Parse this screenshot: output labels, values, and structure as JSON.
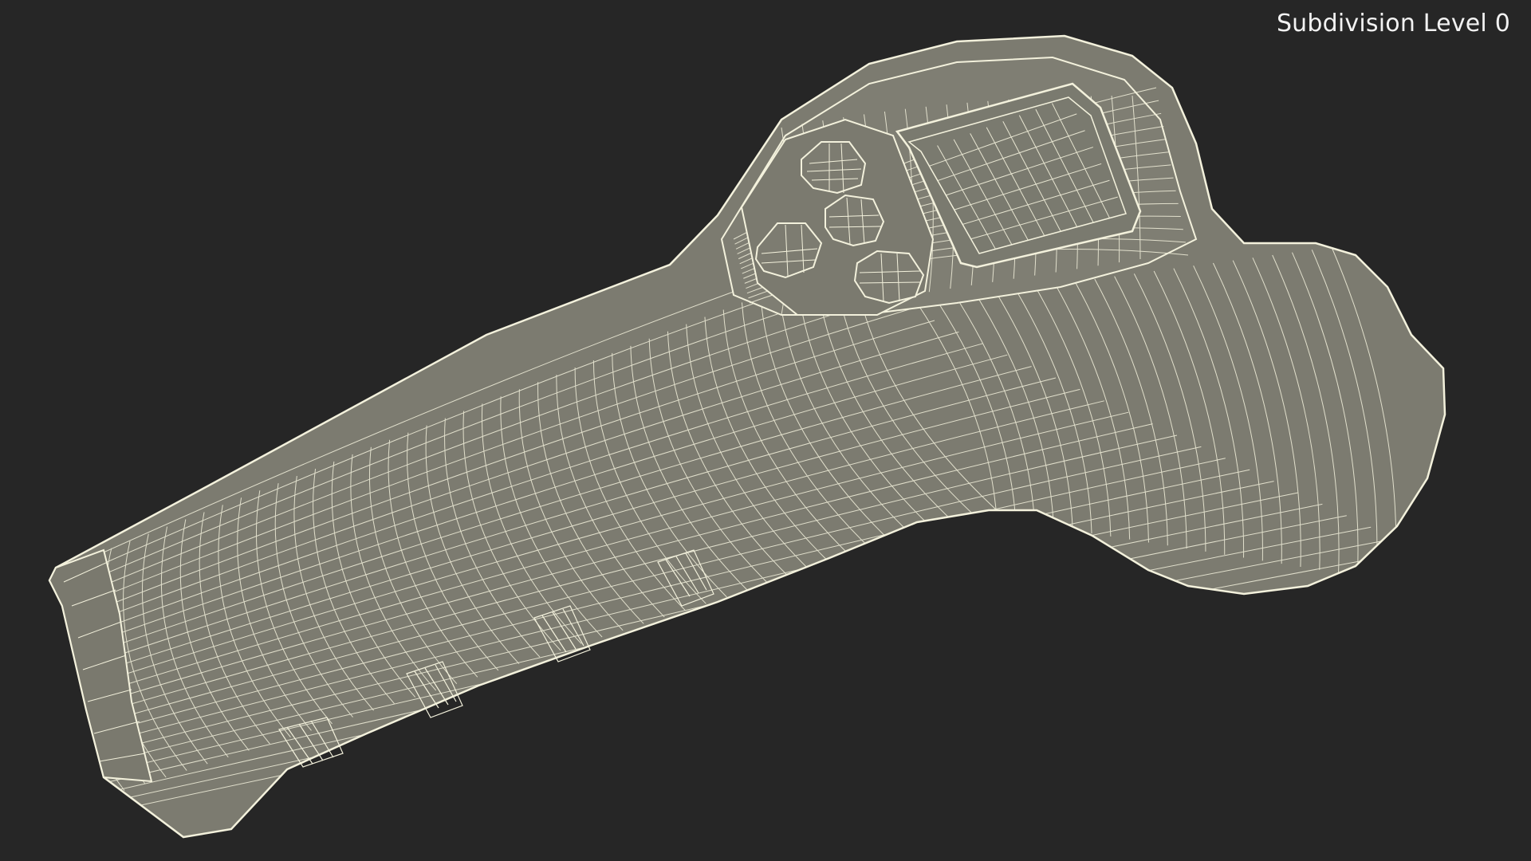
{
  "viewport": {
    "label": "Subdivision Level 0",
    "background_color": "#262626",
    "mesh_fill_color": "#7c7b70",
    "wire_color": "#f3f1dc"
  }
}
